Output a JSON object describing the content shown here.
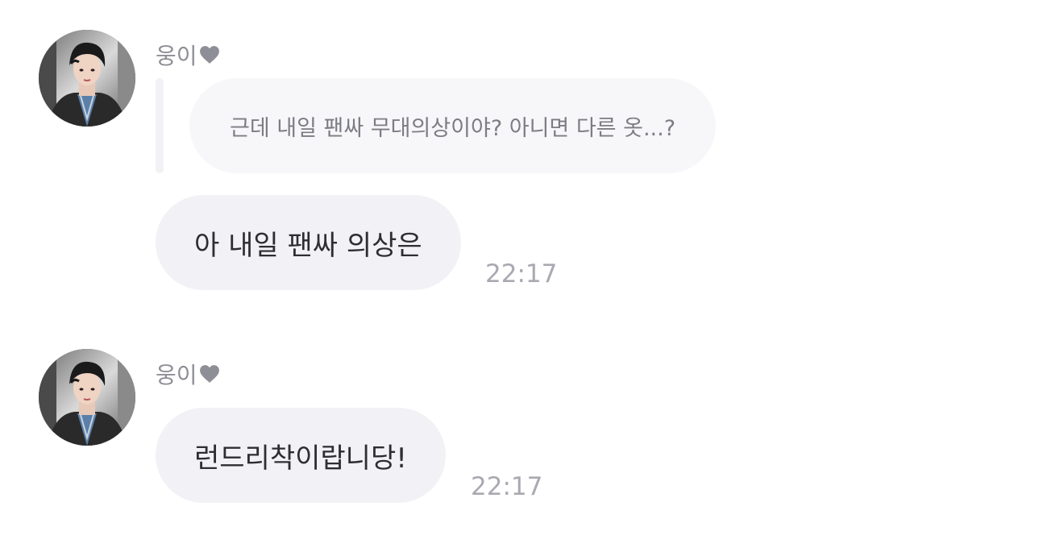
{
  "messages": [
    {
      "sender": "웅이",
      "quote": "근데 내일 팬싸 무대의상이야? 아니면 다른 옷...?",
      "text": "아 내일 팬싸 의상은",
      "time": "22:17"
    },
    {
      "sender": "웅이",
      "text": "런드리착이랍니당!",
      "time": "22:17"
    }
  ],
  "icons": {
    "heart": "heart-icon"
  },
  "colors": {
    "bubble": "#f2f2f6",
    "quote_bubble": "#f7f7f9",
    "time": "#a9a9b1",
    "sender": "#8e8e96"
  }
}
